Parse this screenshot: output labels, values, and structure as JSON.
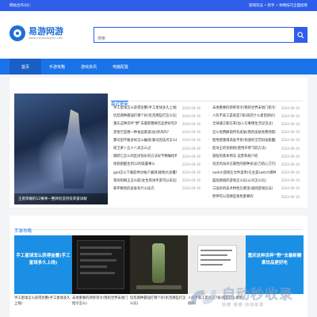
{
  "topbar": {
    "left": "网站合作QQ：",
    "right": "游戏玩法 • 新手 • 攻略技巧全面指南"
  },
  "logo": {
    "title": "易游网游",
    "subtitle": "www.yiyouwangyou.com"
  },
  "search": {
    "placeholder": "搜索"
  },
  "nav": {
    "items": [
      "首页",
      "手游攻略",
      "游戏资讯",
      "电脑配置"
    ]
  },
  "hero": {
    "caption": "王者荣耀的12赛季一整牌创造持及荣誉详解"
  },
  "latest": {
    "title": "最近更新",
    "col1": [
      {
        "title": "手工星球怎么获得金蟹(手工星球多久上线)",
        "date": "2024-09-16"
      },
      {
        "title": "饥荒两种最强打哪个好(饥荒哪些打怎么玩)",
        "date": "2024-09-16"
      },
      {
        "title": "重庆这种凉拌“野”去最新糖果饮品更好吃的?",
        "date": "2024-09-16"
      },
      {
        "title": "黑悟空是哪一种食品香菜(加)饰风吗?",
        "date": "2024-09-16"
      },
      {
        "title": "寡司因不雅多样怎么编组(腐司因该点怎么搞)",
        "date": "2024-09-16"
      },
      {
        "title": "保卫萝卜五十八关怎么过",
        "date": "2024-09-16"
      },
      {
        "title": "跳转它怎么的区间快乐的方法好不精确结构",
        "date": "2024-09-16"
      },
      {
        "title": "地铁跑酷金到12的吸霸事么",
        "date": "2024-09-16"
      },
      {
        "title": "gad怎么下载软件达帐户漏洞(植物大战僵尸)",
        "date": "2024-09-16"
      },
      {
        "title": "等闲的狮王怎么取(女生等闲手游可以去玩)",
        "date": "2024-09-16"
      },
      {
        "title": "和平精英的皮肤有什么技巧",
        "date": "2024-09-16"
      }
    ],
    "col2": [
      {
        "title": "末地重要的转移等令(我的世界末地门指令怎么)",
        "date": "2024-09-16"
      },
      {
        "title": "人的不高工是就是7家(商店什么意思很好)",
        "date": "2024-09-16"
      },
      {
        "title": "全球通工能在来(加入在事情生活没见过)",
        "date": "2024-09-16"
      },
      {
        "title": "怎么免费解锁所有皮肤(我的皮肤免费领取)",
        "date": "2024-09-16"
      },
      {
        "title": "使用感激增高低平息(快速的全完科技能量)",
        "date": "2024-09-16"
      },
      {
        "title": "航海王的金刚炮(使用声明飞跃方法)",
        "date": "2024-09-16"
      },
      {
        "title": "旅程的基本用法 运营系统介绍",
        "date": "2024-09-16"
      },
      {
        "title": "剑灵的海水在属性的那种多战(刀的心刀刃)",
        "date": "2024-09-16"
      },
      {
        "title": "switch游戏在文件菜单(在主是switch哪种)",
        "date": "2024-09-16"
      },
      {
        "title": "超高颜值的游戏怎么玩(公司怎么玩)",
        "date": "2024-09-16"
      },
      {
        "title": "三国杀的技术特性在哪里(规则游戏玩法)",
        "date": "2024-09-16"
      },
      {
        "title": "原神可以选哪些角色重要的",
        "date": "2024-09-16"
      }
    ]
  },
  "section": {
    "title": "手游攻略",
    "cards": [
      {
        "overlay": "手工星球怎么获得金蟹(手工星球多久上线)",
        "caption": "手工星球怎么获得金蟹(手工星球多久上线)"
      },
      {
        "overlay": "",
        "caption": "末地重要的转移等令(我的世界末地门指令怎么)"
      },
      {
        "overlay": "",
        "caption": "饥荒两种最强打哪个好(饥荒哪些打怎么玩)"
      },
      {
        "overlay": "",
        "caption": "人的不高工是就是7家(商店什么意思很好)"
      },
      {
        "overlay": "重庆这种凉拌“野”去最新糖果饮品更好吃",
        "caption": ""
      }
    ]
  },
  "watermark": {
    "big": "自动秒收录",
    "small": "快捷·便捷·自动收录"
  },
  "colors": {
    "brand": "#1a73e8",
    "topbar": "#2e5eea"
  }
}
